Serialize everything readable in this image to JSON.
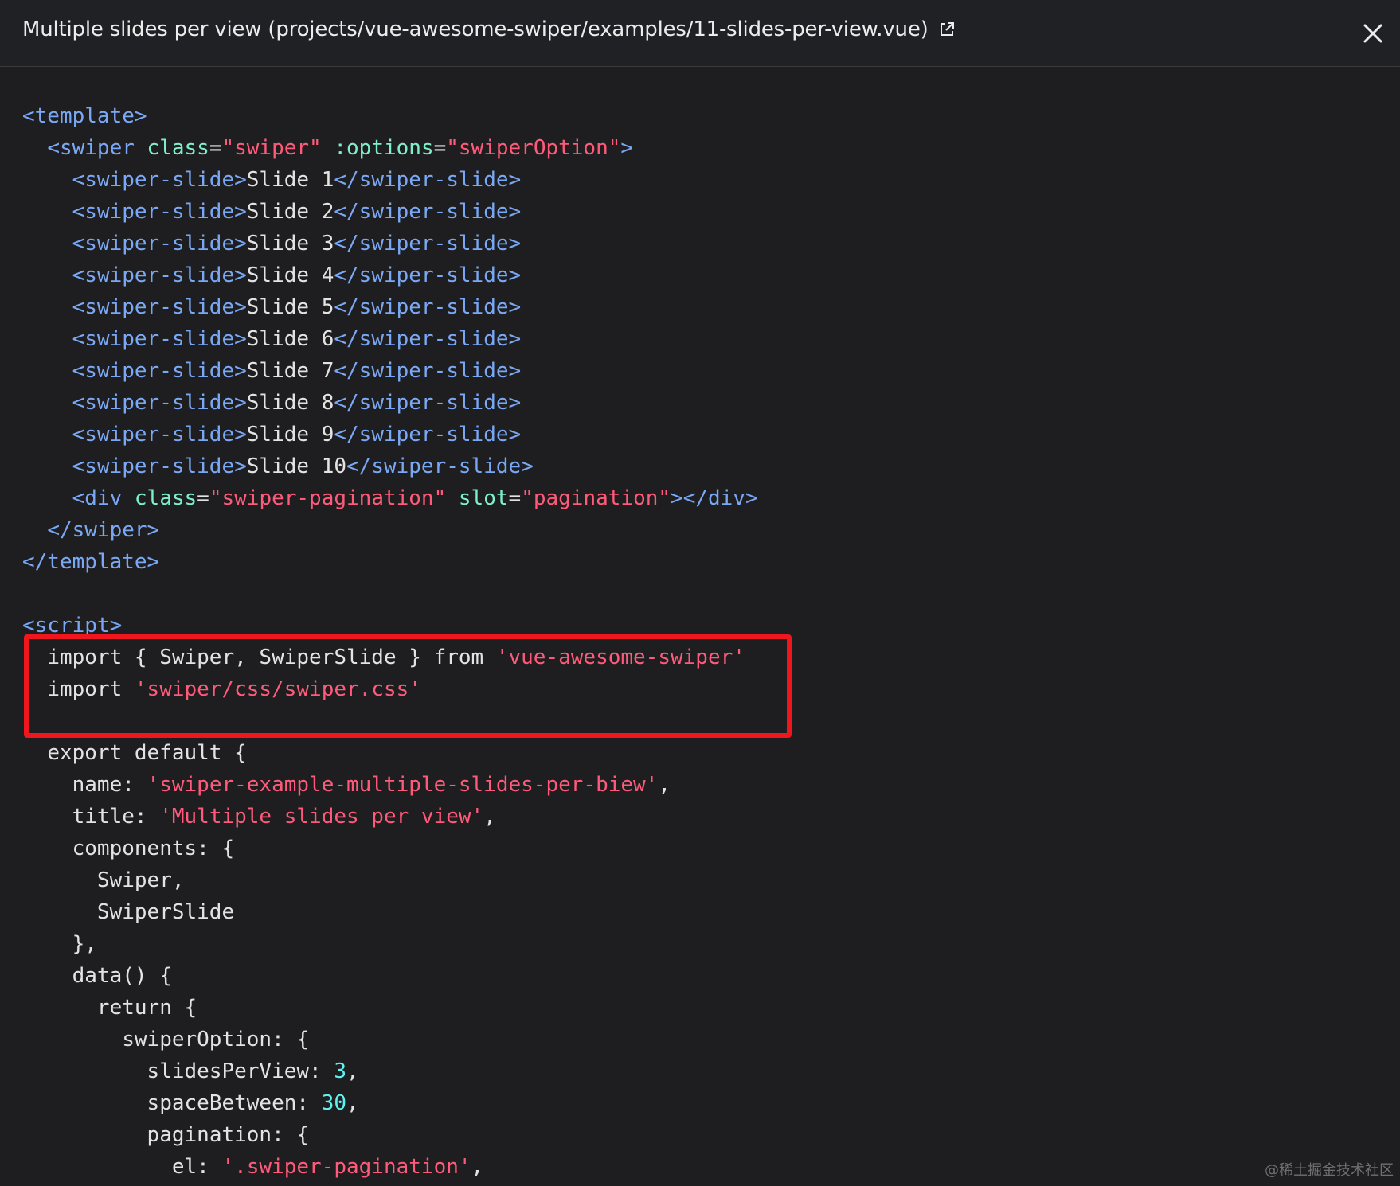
{
  "header": {
    "title": "Multiple slides per view (projects/vue-awesome-swiper/examples/11-slides-per-view.vue)"
  },
  "code": {
    "lines": [
      "<template>",
      "  <swiper class=\"swiper\" :options=\"swiperOption\">",
      "    <swiper-slide>Slide 1</swiper-slide>",
      "    <swiper-slide>Slide 2</swiper-slide>",
      "    <swiper-slide>Slide 3</swiper-slide>",
      "    <swiper-slide>Slide 4</swiper-slide>",
      "    <swiper-slide>Slide 5</swiper-slide>",
      "    <swiper-slide>Slide 6</swiper-slide>",
      "    <swiper-slide>Slide 7</swiper-slide>",
      "    <swiper-slide>Slide 8</swiper-slide>",
      "    <swiper-slide>Slide 9</swiper-slide>",
      "    <swiper-slide>Slide 10</swiper-slide>",
      "    <div class=\"swiper-pagination\" slot=\"pagination\"></div>",
      "  </swiper>",
      "</template>",
      "",
      "<script>",
      "  import { Swiper, SwiperSlide } from 'vue-awesome-swiper'",
      "  import 'swiper/css/swiper.css'",
      "",
      "  export default {",
      "    name: 'swiper-example-multiple-slides-per-biew',",
      "    title: 'Multiple slides per view',",
      "    components: {",
      "      Swiper,",
      "      SwiperSlide",
      "    },",
      "    data() {",
      "      return {",
      "        swiperOption: {",
      "          slidesPerView: 3,",
      "          spaceBetween: 30,",
      "          pagination: {",
      "            el: '.swiper-pagination',"
    ]
  },
  "watermark": "@稀土掘金技术社区",
  "colors": {
    "background": "#1e1e20",
    "tag": "#7aa8f5",
    "attribute": "#7ef0c8",
    "string": "#ff5a7a",
    "number": "#5ff0f0",
    "highlight_box": "#f0161e"
  }
}
